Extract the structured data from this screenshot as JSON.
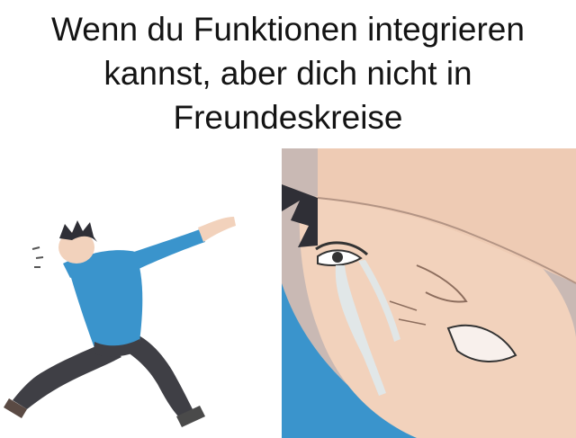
{
  "caption": {
    "lines": [
      "Wenn du Funktionen integrieren",
      "kannst, aber dich nicht in",
      "Freundeskreise"
    ]
  },
  "colors": {
    "shirt": "#3a94cc",
    "pants": "#3f3f45",
    "skin": "#f2d2bc",
    "hair": "#2f2f36",
    "background": "#ffffff"
  },
  "panels": {
    "left": "dabbing-character-illustration",
    "right": "crying-character-closeup-illustration"
  }
}
